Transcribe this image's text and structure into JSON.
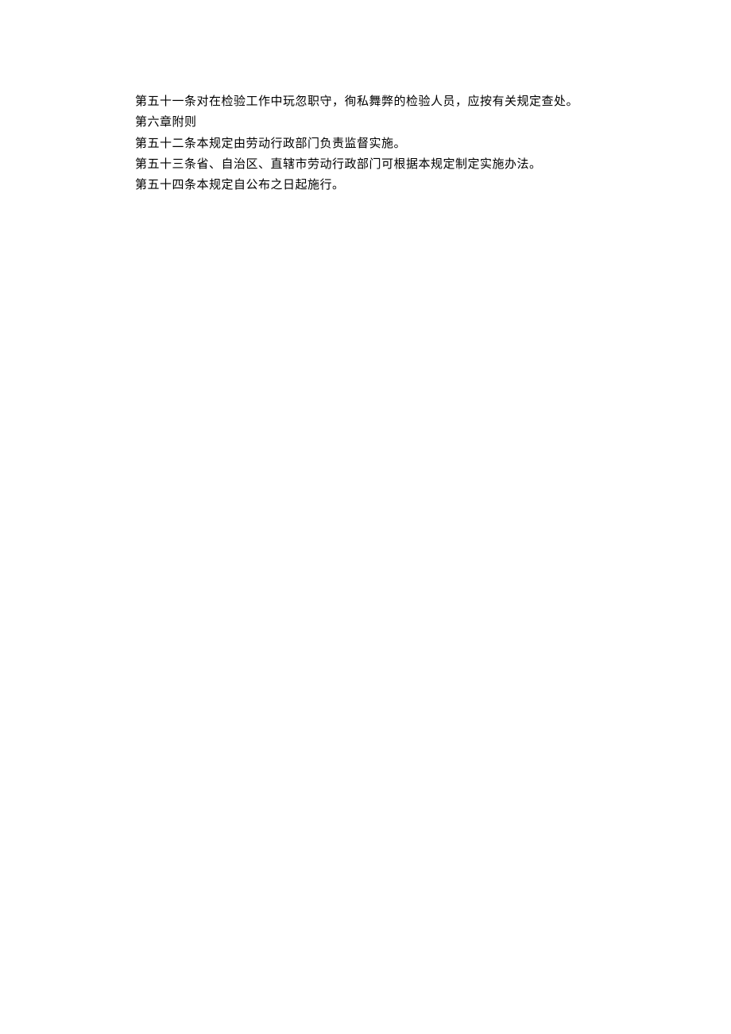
{
  "lines": [
    "第五十一条对在检验工作中玩忽职守，徇私舞弊的检验人员，应按有关规定查处。",
    "第六章附则",
    "第五十二条本规定由劳动行政部门负责监督实施。",
    "第五十三条省、自治区、直辖市劳动行政部门可根据本规定制定实施办法。",
    "第五十四条本规定自公布之日起施行。"
  ]
}
